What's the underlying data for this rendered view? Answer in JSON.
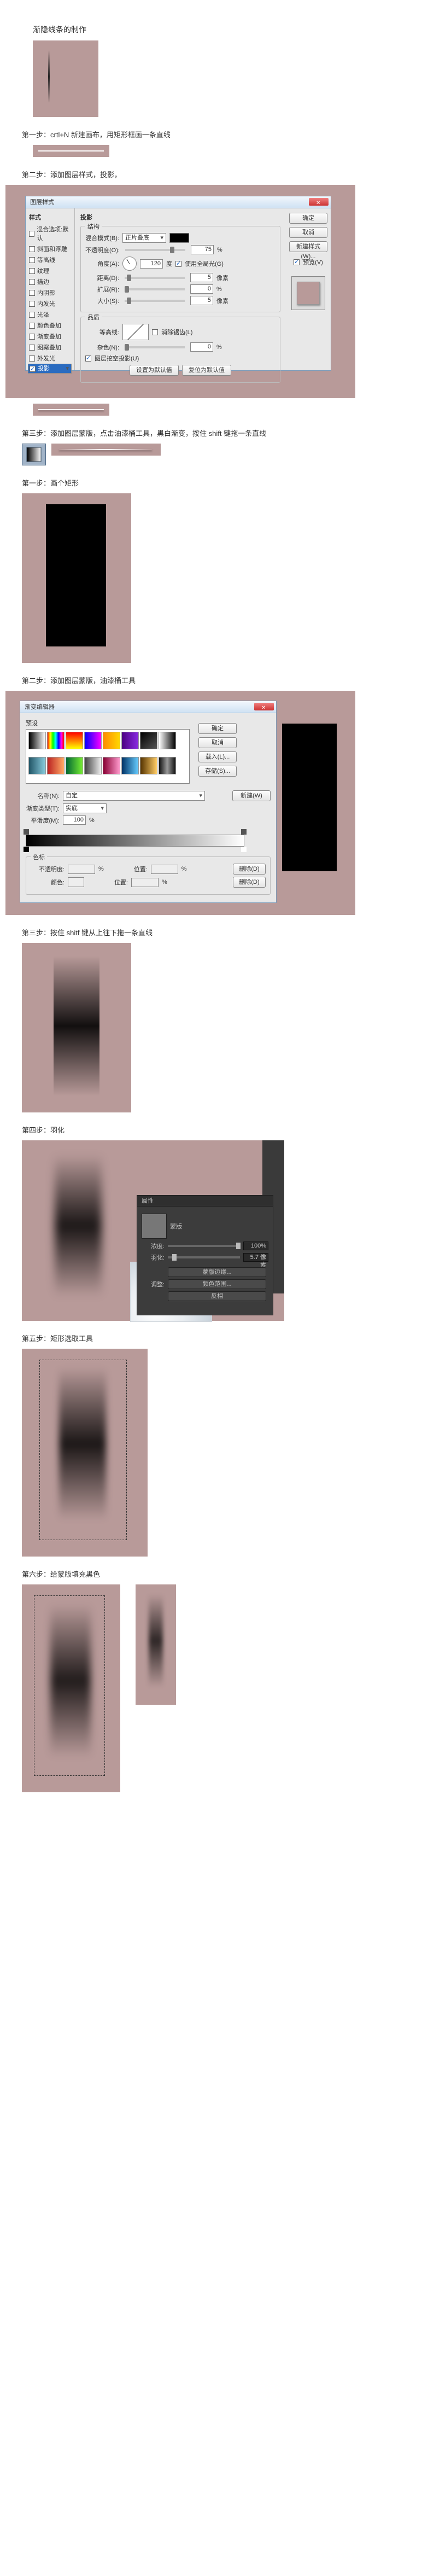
{
  "title": "渐隐线条的制作",
  "method_a": {
    "step1": "第一步：crtl+N 新建画布，用矩形框画一条直线",
    "step2": "第二步：添加图层样式，投影，",
    "step3": "第三步：添加图层蒙版，点击油漆桶工具，黑白渐变，按住 shift 键拖一条直线"
  },
  "method_b": {
    "step1": "第一步：画个矩形",
    "step2": "第二步：添加图层蒙版，油漆桶工具",
    "step3": "第三步：按住 shitf 键从上往下拖一条直线",
    "step4": "第四步：羽化",
    "step5": "第五步：矩形选取工具",
    "step6": "第六步：给蒙版填充黑色"
  },
  "layer_style_dialog": {
    "title": "图层样式",
    "styles_header": "样式",
    "blend_options": "混合选项:默认",
    "styles": [
      "斜面和浮雕",
      "等高线",
      "纹理",
      "描边",
      "内阴影",
      "内发光",
      "光泽",
      "颜色叠加",
      "渐变叠加",
      "图案叠加",
      "外发光",
      "投影"
    ],
    "selected_style": "投影",
    "section_structure": "结构",
    "blend_mode_label": "混合模式(B):",
    "blend_mode_value": "正片叠底",
    "opacity_label": "不透明度(O):",
    "opacity_value": "75",
    "angle_label": "角度(A):",
    "angle_value": "120",
    "angle_unit": "度",
    "global_light": "使用全局光(G)",
    "distance_label": "距离(D):",
    "distance_value": "5",
    "spread_label": "扩展(R):",
    "spread_value": "0",
    "size_label": "大小(S):",
    "size_value": "5",
    "unit_px": "像素",
    "unit_pct": "%",
    "section_quality": "品质",
    "contour_label": "等高线:",
    "antialias": "消除锯齿(L)",
    "noise_label": "杂色(N):",
    "noise_value": "0",
    "knockout": "图层挖空投影(U)",
    "make_default": "设置为默认值",
    "reset_default": "复位为默认值",
    "btn_ok": "确定",
    "btn_cancel": "取消",
    "btn_new": "新建样式(W)...",
    "preview": "预览(V)"
  },
  "gradient_editor": {
    "title": "渐变编辑器",
    "presets_label": "预设",
    "btn_ok": "确定",
    "btn_cancel": "取消",
    "btn_load": "载入(L)...",
    "btn_save": "存储(S)...",
    "name_label": "名称(N):",
    "name_value": "自定",
    "btn_new": "新建(W)",
    "type_label": "渐变类型(T):",
    "type_value": "实底",
    "smooth_label": "平滑度(M):",
    "smooth_value": "100",
    "stops_label": "色标",
    "opacity_label": "不透明度:",
    "location_label": "位置:",
    "color_label": "颜色:",
    "btn_delete": "删除(D)",
    "unit_pct": "%"
  },
  "properties_panel": {
    "title": "属性",
    "mask_label": "蒙版",
    "density_label": "浓度:",
    "density_value": "100%",
    "feather_label": "羽化:",
    "feather_value": "5.7 像素",
    "refine_label": "调整:",
    "btn_mask_edge": "蒙版边缘...",
    "btn_color_range": "颜色范围...",
    "btn_invert": "反相"
  },
  "preset_gradients": [
    "linear-gradient(to right,#000,#fff)",
    "linear-gradient(to right,#f00,#ff0,#0f0,#0ff,#00f,#f0f,#f00)",
    "linear-gradient(to bottom,#f00,#ff0)",
    "linear-gradient(to right,#00f,#f0f)",
    "linear-gradient(to right,#ff8c00,#ffd700)",
    "linear-gradient(to right,#4b0082,#8a2be2)",
    "linear-gradient(to bottom right,#000,#555)",
    "linear-gradient(to right,transparent,#000)",
    "linear-gradient(to right,#256,#8cd)",
    "linear-gradient(to right,#b22,#fa6)",
    "linear-gradient(to right,#063,#7e3)",
    "linear-gradient(to right,#444,#eee)",
    "linear-gradient(to right,#803,#f9c)",
    "linear-gradient(to right,#036,#6cf)",
    "linear-gradient(to right,#530,#fc6)",
    "linear-gradient(to right,#111,#999,#111)"
  ]
}
